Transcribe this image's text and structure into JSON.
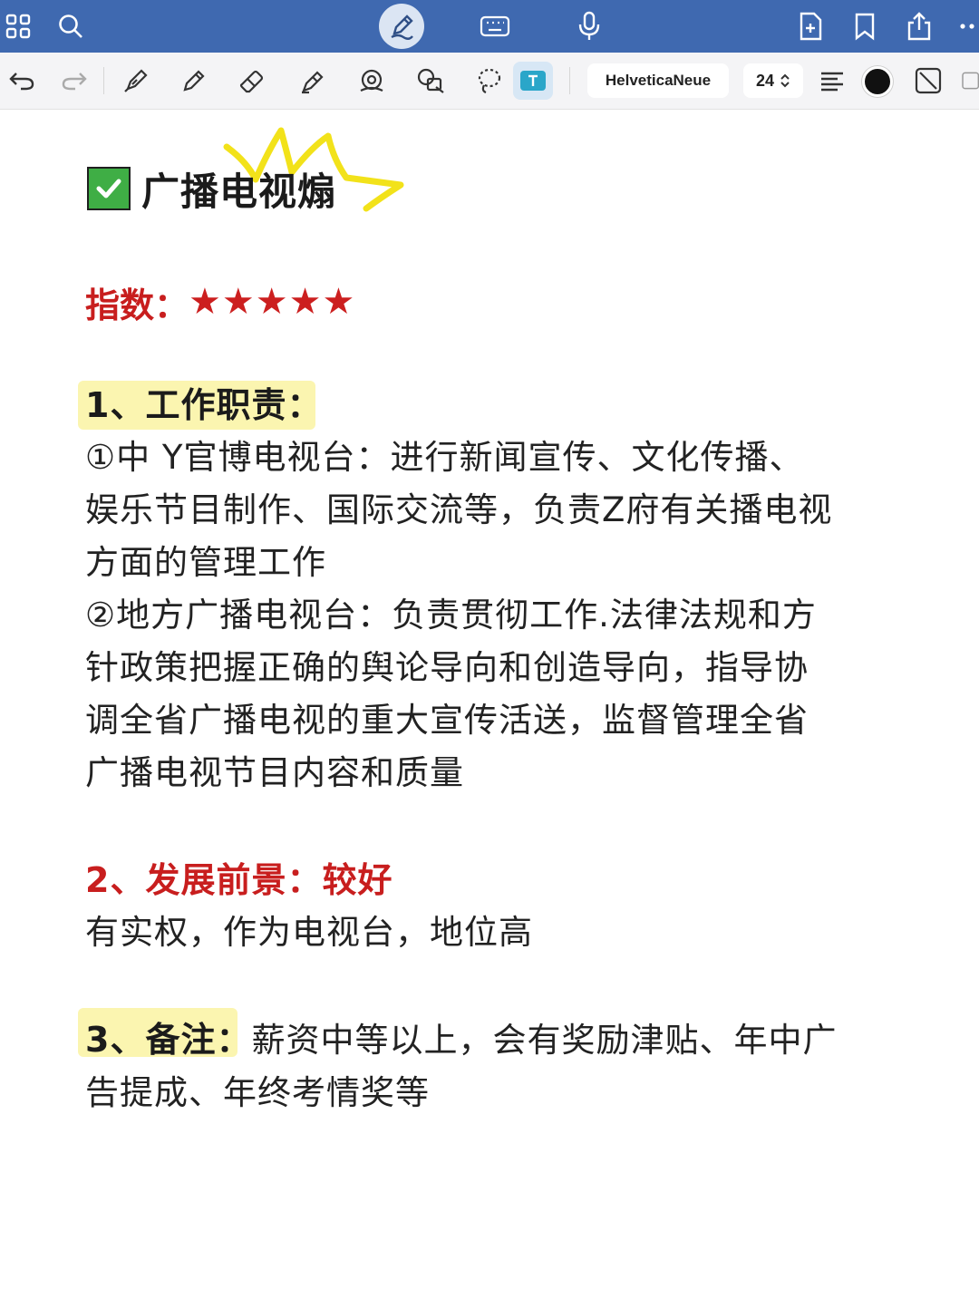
{
  "colors": {
    "topbar": "#3f69b0",
    "accent_red": "#c81e1e",
    "highlight_yellow": "#fbf5b0",
    "checkbox_green": "#3fae45"
  },
  "toolbar": {
    "font_name": "HelveticaNeue",
    "font_size": "24"
  },
  "note": {
    "title": "广播电视煽",
    "index_label": "指数：",
    "stars": "★★★★★",
    "section1_heading": "1、工作职责：",
    "section1_line1": "①中 Y官博电视台：进行新闻宣传、文化传播、",
    "section1_line2": "娱乐节目制作、国际交流等，负责Z府有关播电视",
    "section1_line3": "方面的管理工作",
    "section1_line4": "②地方广播电视台：负责贯彻工作.法律法规和方",
    "section1_line5": "针政策把握正确的舆论导向和创造导向，指导协",
    "section1_line6": "调全省广播电视的重大宣传活送，监督管理全省",
    "section1_line7": "广播电视节目内容和质量",
    "section2_heading": "2、发展前景：较好",
    "section2_line1": "有实权，作为电视台，地位高",
    "section3_heading": "3、备注：",
    "section3_line1_rest": "薪资中等以上，会有奖励津贴、年中广",
    "section3_line2": "告提成、年终考情奖等"
  }
}
